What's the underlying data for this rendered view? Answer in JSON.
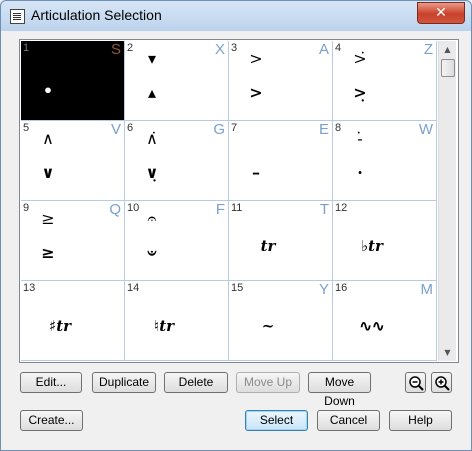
{
  "window": {
    "title": "Articulation Selection",
    "close_glyph": "✕"
  },
  "cells": [
    {
      "num": "1",
      "key": "S",
      "selected": true,
      "top": "",
      "bottom": "•"
    },
    {
      "num": "2",
      "key": "X",
      "top": "▾",
      "bottom": "▴"
    },
    {
      "num": "3",
      "key": "A",
      "top": ">",
      "bottom": ">"
    },
    {
      "num": "4",
      "key": "Z",
      "top": ">̇",
      "bottom": ">̣"
    },
    {
      "num": "5",
      "key": "V",
      "top": "∧",
      "bottom": "∨"
    },
    {
      "num": "6",
      "key": "G",
      "top": "∧̇",
      "bottom": "∨̣"
    },
    {
      "num": "7",
      "key": "E",
      "top": "",
      "bottom": "–"
    },
    {
      "num": "8",
      "key": "W",
      "top": "-̇",
      "bottom": "·"
    },
    {
      "num": "9",
      "key": "Q",
      "top": "≥",
      "bottom": "≥"
    },
    {
      "num": "10",
      "key": "F",
      "top": "𝄐",
      "bottom": "𝄑"
    },
    {
      "num": "11",
      "key": "T",
      "top": "",
      "bottom": "tr"
    },
    {
      "num": "12",
      "key": "",
      "top": "",
      "bottom": "♭tr"
    },
    {
      "num": "13",
      "key": "",
      "top": "",
      "bottom": "♯tr"
    },
    {
      "num": "14",
      "key": "",
      "top": "",
      "bottom": "♮tr"
    },
    {
      "num": "15",
      "key": "Y",
      "top": "",
      "bottom": "~"
    },
    {
      "num": "16",
      "key": "M",
      "top": "",
      "bottom": "∿∿"
    }
  ],
  "buttons": {
    "edit": "Edit...",
    "duplicate": "Duplicate",
    "delete": "Delete",
    "move_up": "Move Up",
    "move_down": "Move Down",
    "create": "Create...",
    "select": "Select",
    "cancel": "Cancel",
    "help": "Help"
  },
  "icons": {
    "zoom_out": "zoom-out-icon",
    "zoom_in": "zoom-in-icon",
    "close": "close-icon"
  }
}
